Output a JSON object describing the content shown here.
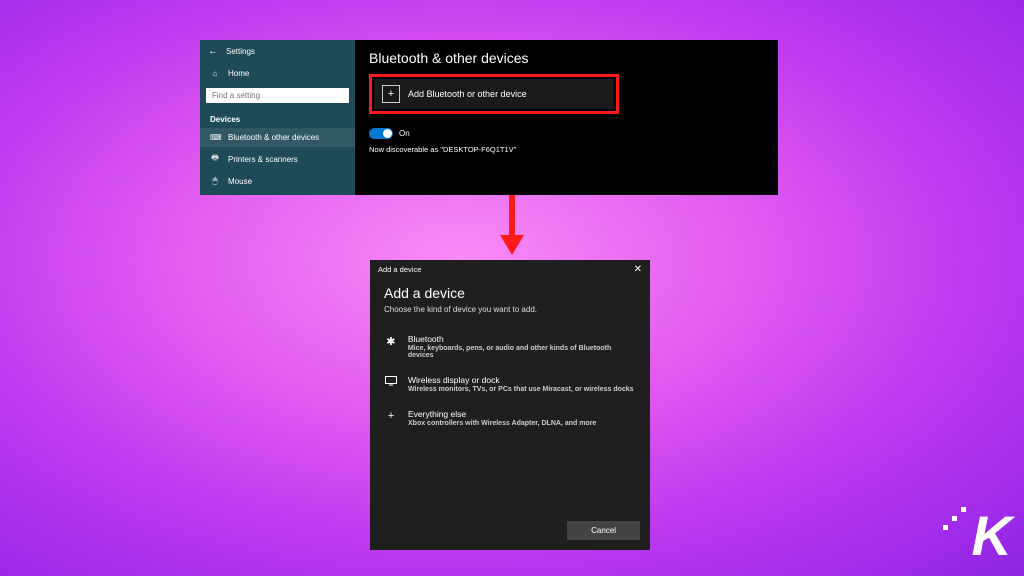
{
  "settings": {
    "titlebar_label": "Settings",
    "home_label": "Home",
    "search_placeholder": "Find a setting",
    "section": "Devices",
    "nav": [
      {
        "icon": "⌨",
        "label": "Bluetooth & other devices"
      },
      {
        "icon": "🖶",
        "label": "Printers & scanners"
      },
      {
        "icon": "🖱",
        "label": "Mouse"
      }
    ],
    "page_title": "Bluetooth & other devices",
    "add_button_label": "Add Bluetooth or other device",
    "toggle_label": "On",
    "discoverable_text": "Now discoverable as \"DESKTOP-F6Q1T1V\""
  },
  "dialog": {
    "titlebar": "Add a device",
    "heading": "Add a device",
    "subheading": "Choose the kind of device you want to add.",
    "options": [
      {
        "icon": "✱",
        "title": "Bluetooth",
        "desc": "Mice, keyboards, pens, or audio and other kinds of Bluetooth devices"
      },
      {
        "icon": "⌧",
        "title": "Wireless display or dock",
        "desc": "Wireless monitors, TVs, or PCs that use Miracast, or wireless docks"
      },
      {
        "icon": "+",
        "title": "Everything else",
        "desc": "Xbox controllers with Wireless Adapter, DLNA, and more"
      }
    ],
    "cancel_label": "Cancel"
  },
  "logo_letter": "K"
}
